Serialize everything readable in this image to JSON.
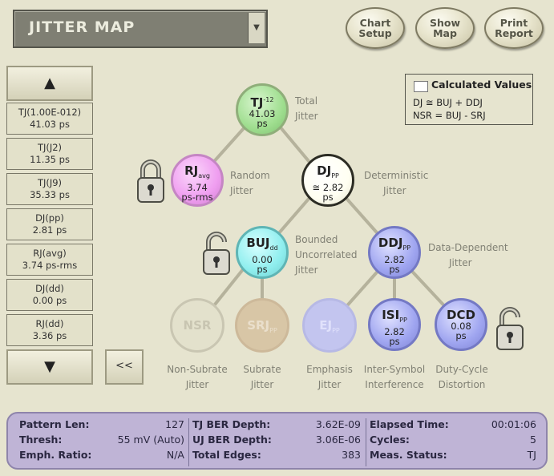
{
  "header": {
    "title": "JITTER MAP",
    "buttons": {
      "chart_setup": [
        "Chart",
        "Setup"
      ],
      "show_map": [
        "Show",
        "Map"
      ],
      "print_report": [
        "Print",
        "Report"
      ]
    }
  },
  "list": {
    "items": [
      {
        "name": "TJ(1.00E-012)",
        "value": "41.03 ps"
      },
      {
        "name": "TJ(J2)",
        "value": "11.35 ps"
      },
      {
        "name": "TJ(J9)",
        "value": "35.33 ps"
      },
      {
        "name": "DJ(pp)",
        "value": "2.81 ps"
      },
      {
        "name": "RJ(avg)",
        "value": "3.74 ps-rms"
      },
      {
        "name": "DJ(dd)",
        "value": "0.00 ps"
      },
      {
        "name": "RJ(dd)",
        "value": "3.36 ps"
      }
    ],
    "back_label": "<<"
  },
  "legend": {
    "title": "Calculated Values",
    "formula1": "DJ ≅ BUJ + DDJ",
    "formula2": "NSR = BUJ - SRJ"
  },
  "map": {
    "tj": {
      "name": "TJ",
      "sup": "-12",
      "value": "41.03",
      "unit": "ps",
      "desc": [
        "Total",
        "Jitter"
      ]
    },
    "rj": {
      "name": "RJ",
      "sub": "avg",
      "value": "3.74",
      "unit": "ps-rms",
      "desc": [
        "Random",
        "Jitter"
      ]
    },
    "dj": {
      "name": "DJ",
      "sub": "PP",
      "value": "≅ 2.82",
      "unit": "ps",
      "desc": [
        "Deterministic",
        "Jitter"
      ]
    },
    "buj": {
      "name": "BUJ",
      "sub": "dd",
      "value": "0.00",
      "unit": "ps",
      "desc": [
        "Bounded",
        "Uncorrelated",
        "Jitter"
      ]
    },
    "ddj": {
      "name": "DDJ",
      "sub": "PP",
      "value": "2.82",
      "unit": "ps",
      "desc": [
        "Data-Dependent",
        "Jitter"
      ]
    },
    "nsr": {
      "name": "NSR",
      "desc": [
        "Non-Subrate",
        "Jitter"
      ]
    },
    "srj": {
      "name": "SRJ",
      "sub": "PP",
      "desc": [
        "Subrate",
        "Jitter"
      ]
    },
    "ej": {
      "name": "EJ",
      "sub": "PP",
      "desc": [
        "Emphasis",
        "Jitter"
      ]
    },
    "isi": {
      "name": "ISI",
      "sub": "PP",
      "value": "2.82",
      "unit": "ps",
      "desc": [
        "Inter-Symbol",
        "Interference"
      ]
    },
    "dcd": {
      "name": "DCD",
      "value": "0.08",
      "unit": "ps",
      "desc": [
        "Duty-Cycle",
        "Distortion"
      ]
    }
  },
  "status": {
    "pattern_len": {
      "label": "Pattern Len:",
      "value": "127"
    },
    "thresh": {
      "label": "Thresh:",
      "value": "55 mV (Auto)"
    },
    "emph_ratio": {
      "label": "Emph. Ratio:",
      "value": "N/A"
    },
    "tj_ber": {
      "label": "TJ BER Depth:",
      "value": "3.62E-09"
    },
    "uj_ber": {
      "label": "UJ BER Depth:",
      "value": "3.06E-06"
    },
    "total_edges": {
      "label": "Total Edges:",
      "value": "383"
    },
    "elapsed": {
      "label": "Elapsed Time:",
      "value": "00:01:06"
    },
    "cycles": {
      "label": "Cycles:",
      "value": "5"
    },
    "meas_status": {
      "label": "Meas. Status:",
      "value": "TJ"
    }
  },
  "colors": {
    "tj": "#9fde8f",
    "rj": "#ef9ef0",
    "dj": "#fffff2",
    "buj": "#8feeee",
    "ddj": "#9fa5f0",
    "isi": "#9fa5f0",
    "dcd": "#9fa5f0",
    "nsr_faded": "#dcdac6",
    "srj_faded": "#d8c6a6",
    "ej_faded": "#c3c5ef",
    "status_bg": "#bfb4d6"
  },
  "icons": [
    "padlock-icon",
    "up-arrow-icon",
    "down-arrow-icon",
    "dropdown-arrow-icon"
  ]
}
